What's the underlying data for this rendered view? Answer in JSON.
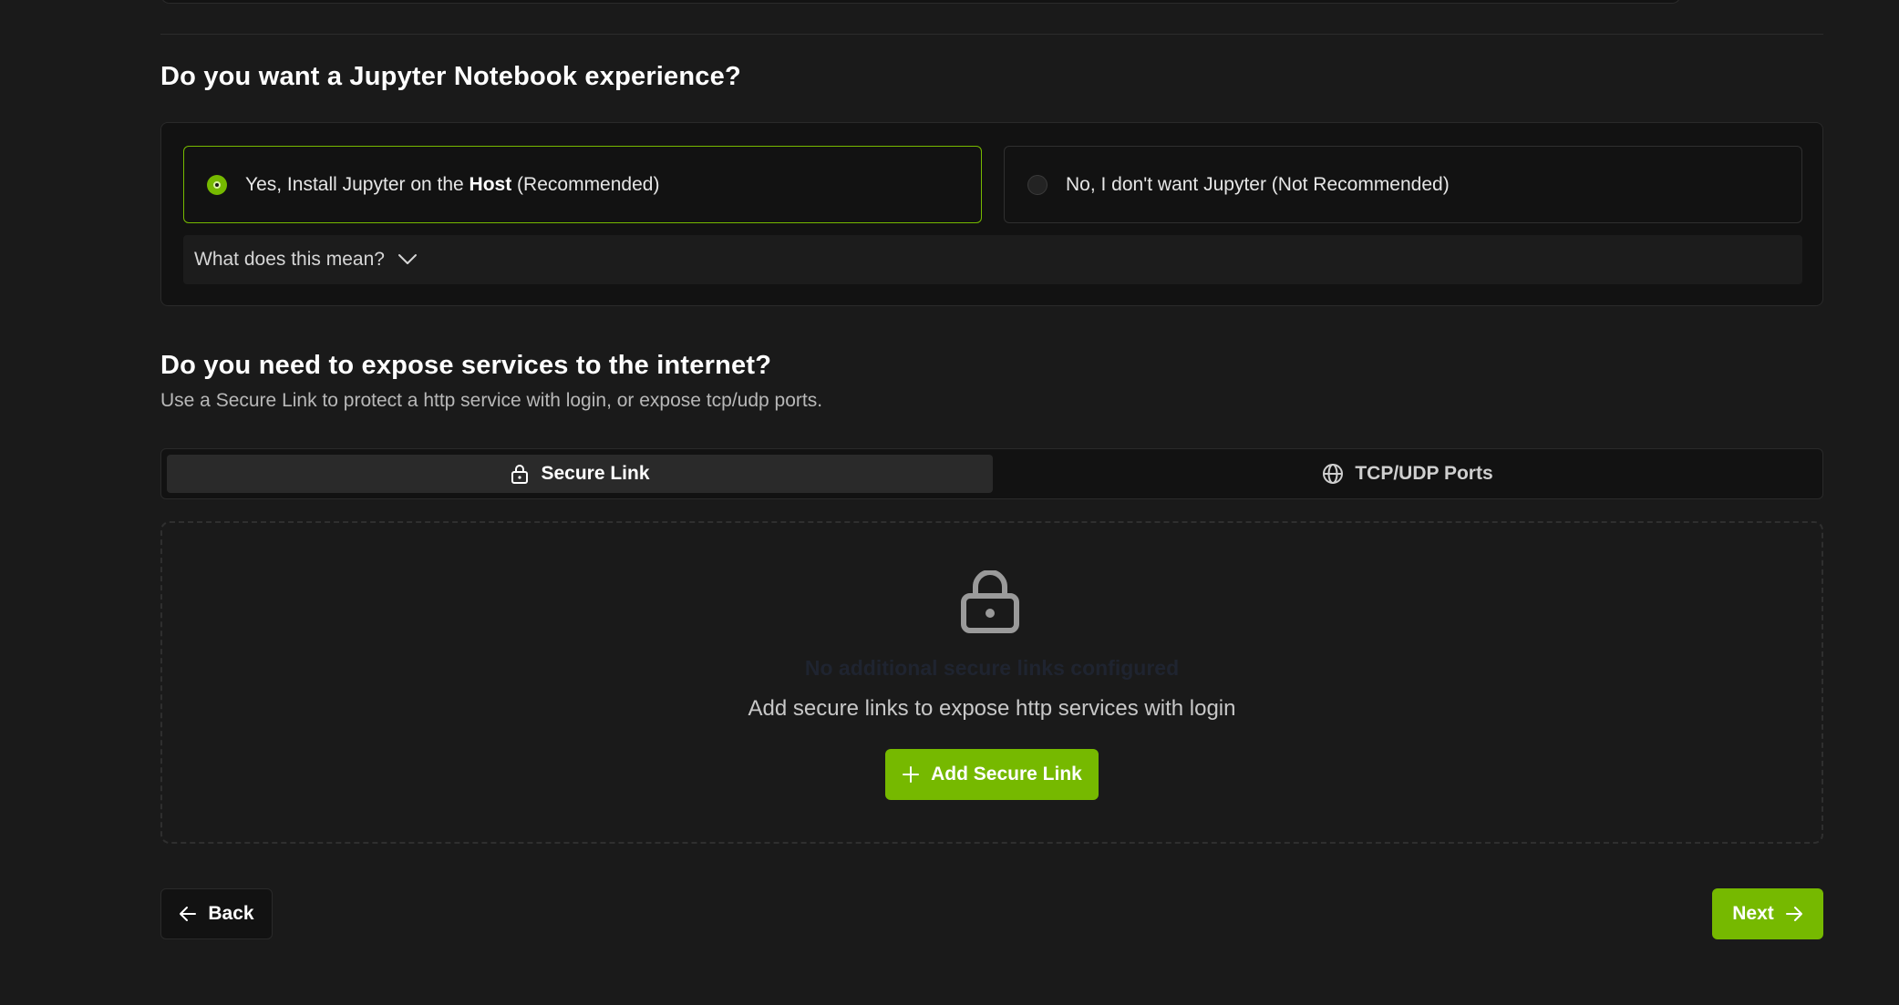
{
  "jupyter": {
    "heading": "Do you want a Jupyter Notebook experience?",
    "option_yes": {
      "prefix": "Yes, Install Jupyter on the ",
      "emphasis": "Host",
      "suffix": " (Recommended)",
      "selected": true
    },
    "option_no": {
      "label": "No, I don't want Jupyter (Not Recommended)",
      "selected": false
    },
    "explain_label": "What does this mean?",
    "explain_icon": "chevron-down-icon"
  },
  "expose": {
    "heading": "Do you need to expose services to the internet?",
    "subheading": "Use a Secure Link to protect a http service with login, or expose tcp/udp ports.",
    "tabs": [
      {
        "label": "Secure Link",
        "icon": "lock-icon",
        "active": true
      },
      {
        "label": "TCP/UDP Ports",
        "icon": "globe-icon",
        "active": false
      }
    ],
    "empty_state": {
      "icon": "lock-icon",
      "title": "No additional secure links configured",
      "description": "Add secure links to expose http services with login",
      "add_button_label": "Add Secure Link",
      "add_button_icon": "plus-icon"
    }
  },
  "footer": {
    "back_label": "Back",
    "back_icon": "arrow-left-icon",
    "next_label": "Next",
    "next_icon": "arrow-right-icon"
  },
  "colors": {
    "accent": "#76b900",
    "background": "#1a1a1a",
    "panel": "#121212"
  }
}
